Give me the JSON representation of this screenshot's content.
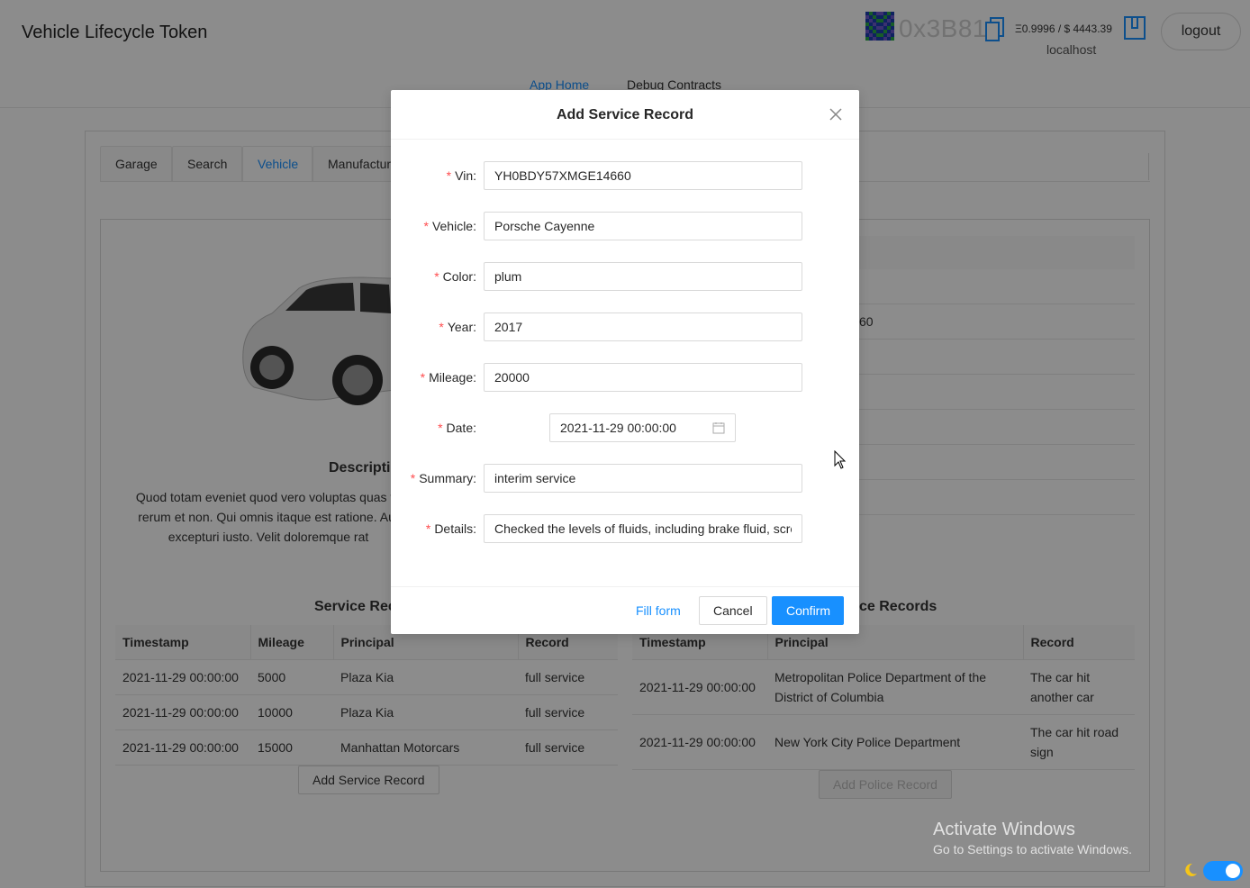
{
  "header": {
    "app_title": "Vehicle Lifecycle Token",
    "address": "0x3B81",
    "balance": "Ξ0.9996 / $ 4443.39",
    "network": "localhost",
    "logout_label": "logout",
    "nav": [
      {
        "label": "App Home"
      },
      {
        "label": "Debug Contracts"
      }
    ]
  },
  "tabs": [
    {
      "label": "Garage"
    },
    {
      "label": "Search"
    },
    {
      "label": "Vehicle"
    },
    {
      "label": "Manufactur"
    }
  ],
  "vehicle": {
    "description_title": "Descripti",
    "description_text": "Quod totam eveniet quod vero voluptas quas fu\nrerum et non. Qui omnis itaque est ratione. Aut\nexcepturi iusto. Velit doloremque rat",
    "right_fragment": "60"
  },
  "service_records": {
    "title": "Service Rec",
    "columns": [
      "Timestamp",
      "Mileage",
      "Principal",
      "Record"
    ],
    "rows": [
      {
        "timestamp": "2021-11-29 00:00:00",
        "mileage": "5000",
        "principal": "Plaza Kia",
        "record": "full service"
      },
      {
        "timestamp": "2021-11-29 00:00:00",
        "mileage": "10000",
        "principal": "Plaza Kia",
        "record": "full service"
      },
      {
        "timestamp": "2021-11-29 00:00:00",
        "mileage": "15000",
        "principal": "Manhattan Motorcars",
        "record": "full service"
      }
    ],
    "add_label": "Add Service Record"
  },
  "police_records": {
    "title": "ce Records",
    "columns": [
      "Timestamp",
      "Principal",
      "Record"
    ],
    "rows": [
      {
        "timestamp": "2021-11-29 00:00:00",
        "principal": "Metropolitan Police Department of the District of Columbia",
        "record": "The car hit another car"
      },
      {
        "timestamp": "2021-11-29 00:00:00",
        "principal": "New York City Police Department",
        "record": "The car hit road sign"
      }
    ],
    "add_label": "Add Police Record"
  },
  "modal": {
    "title": "Add Service Record",
    "fields": {
      "vin": {
        "label": "Vin",
        "value": "YH0BDY57XMGE14660"
      },
      "vehicle": {
        "label": "Vehicle",
        "value": "Porsche Cayenne"
      },
      "color": {
        "label": "Color",
        "value": "plum"
      },
      "year": {
        "label": "Year",
        "value": "2017"
      },
      "mileage": {
        "label": "Mileage",
        "value": "20000"
      },
      "date": {
        "label": "Date",
        "value": "2021-11-29 00:00:00"
      },
      "summary": {
        "label": "Summary",
        "value": "interim service"
      },
      "details": {
        "label": "Details",
        "value": "Checked the levels of fluids, including brake fluid, screen wash"
      }
    },
    "fill_form_label": "Fill form",
    "cancel_label": "Cancel",
    "confirm_label": "Confirm"
  },
  "watermark": {
    "line1": "Activate Windows",
    "line2": "Go to Settings to activate Windows."
  },
  "colors": {
    "primary": "#1890ff",
    "required": "#ff4d4f"
  }
}
